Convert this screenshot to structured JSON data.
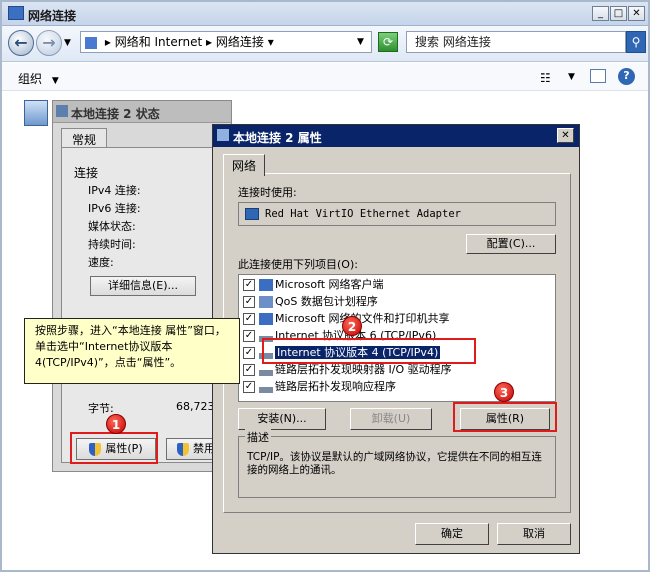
{
  "outer_window": {
    "title": "网络连接",
    "breadcrumb": [
      "网络和 Internet",
      "网络连接"
    ],
    "search_placeholder": "搜索 网络连接",
    "toolbar_organize": "组织"
  },
  "status_window": {
    "title": "本地连接 2 状态",
    "tab": "常规",
    "section_connection": "连接",
    "fields": [
      "IPv4 连接:",
      "IPv6 连接:",
      "媒体状态:",
      "持续时间:",
      "速度:"
    ],
    "details_button": "详细信息(E)...",
    "bytes_label": "字节:",
    "bytes_value": "68,723,",
    "properties_button": "属性(P)",
    "disable_button": "禁用"
  },
  "properties_dialog": {
    "title": "本地连接 2 属性",
    "tab": "网络",
    "connect_using_label": "连接时使用:",
    "adapter_name": "Red Hat VirtIO Ethernet Adapter",
    "configure_button": "配置(C)...",
    "items_label": "此连接使用下列项目(O):",
    "items": [
      {
        "label": "Microsoft 网络客户端",
        "checked": true,
        "icon": "network-client-icon"
      },
      {
        "label": "QoS 数据包计划程序",
        "checked": true,
        "icon": "qos-icon"
      },
      {
        "label": "Microsoft 网络的文件和打印机共享",
        "checked": true,
        "icon": "file-share-icon"
      },
      {
        "label": "Internet 协议版本 6 (TCP/IPv6)",
        "checked": true,
        "icon": "protocol-icon"
      },
      {
        "label": "Internet 协议版本 4 (TCP/IPv4)",
        "checked": true,
        "icon": "protocol-icon",
        "selected": true
      },
      {
        "label": "链路层拓扑发现映射器 I/O 驱动程序",
        "checked": true,
        "icon": "protocol-icon"
      },
      {
        "label": "链路层拓扑发现响应程序",
        "checked": true,
        "icon": "protocol-icon"
      }
    ],
    "install_button": "安装(N)...",
    "uninstall_button": "卸载(U)",
    "properties_button": "属性(R)",
    "description_label": "描述",
    "description_text": "TCP/IP。该协议是默认的广域网络协议，它提供在不同的相互连接的网络上的通讯。",
    "ok_button": "确定",
    "cancel_button": "取消"
  },
  "annotations": {
    "tip_text": "按照步骤，进入“本地连接 属性”窗口，单击选中“Internet协议版本4(TCP/IPv4)”，点击“属性”。",
    "badge1": "1",
    "badge2": "2",
    "badge3": "3",
    "color": "#e01b1b"
  }
}
